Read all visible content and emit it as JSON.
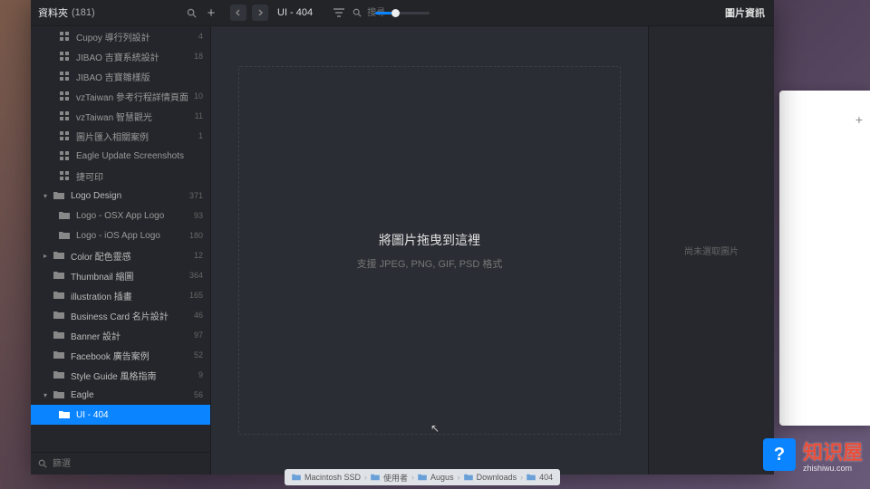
{
  "topbar": {
    "title_label": "資料夾",
    "title_count": "(181)",
    "breadcrumb": "UI - 404",
    "info_label": "圖片資訊",
    "search_placeholder": "搜尋",
    "slider_percent": 30
  },
  "sidebar": {
    "search_placeholder": "篩選",
    "items": [
      {
        "kind": "sub",
        "icon": "grid",
        "label": "Cupoy 導行列設計",
        "count": "4"
      },
      {
        "kind": "sub",
        "icon": "grid",
        "label": "JIBAO 吉寶系統設計",
        "count": "18"
      },
      {
        "kind": "sub",
        "icon": "grid",
        "label": "JIBAO 吉寶雛樣版",
        "count": ""
      },
      {
        "kind": "sub",
        "icon": "grid",
        "label": "vzTaiwan 參考行程詳情頁面",
        "count": "10"
      },
      {
        "kind": "sub",
        "icon": "grid",
        "label": "vzTaiwan 智慧觀光",
        "count": "11"
      },
      {
        "kind": "sub",
        "icon": "grid",
        "label": "圖片匯入相關案例",
        "count": "1"
      },
      {
        "kind": "sub",
        "icon": "grid",
        "label": "Eagle Update Screenshots",
        "count": ""
      },
      {
        "kind": "sub",
        "icon": "grid",
        "label": "捷可印",
        "count": ""
      },
      {
        "kind": "folder",
        "arrow": "▾",
        "label": "Logo Design",
        "count": "371"
      },
      {
        "kind": "sub",
        "icon": "folder",
        "label": "Logo - OSX App Logo",
        "count": "93"
      },
      {
        "kind": "sub",
        "icon": "folder",
        "label": "Logo - iOS App Logo",
        "count": "180"
      },
      {
        "kind": "folder",
        "arrow": "▸",
        "label": "Color 配色靈感",
        "count": "12"
      },
      {
        "kind": "folder",
        "arrow": "",
        "label": "Thumbnail 縮圖",
        "count": "364"
      },
      {
        "kind": "folder",
        "arrow": "",
        "label": "illustration 插畫",
        "count": "165"
      },
      {
        "kind": "folder",
        "arrow": "",
        "label": "Business Card 名片設計",
        "count": "46"
      },
      {
        "kind": "folder",
        "arrow": "",
        "label": "Banner 設計",
        "count": "97"
      },
      {
        "kind": "folder",
        "arrow": "",
        "label": "Facebook 廣告案例",
        "count": "52"
      },
      {
        "kind": "folder",
        "arrow": "",
        "label": "Style Guide 風格指南",
        "count": "9"
      },
      {
        "kind": "folder",
        "arrow": "▾",
        "label": "Eagle",
        "count": "56"
      },
      {
        "kind": "sub",
        "icon": "folder",
        "label": "UI - 404",
        "count": "",
        "selected": true
      }
    ]
  },
  "dropzone": {
    "title": "將圖片拖曳到這裡",
    "subtitle": "支援 JPEG, PNG, GIF, PSD 格式"
  },
  "info_panel": {
    "empty_text": "尚未選取圖片"
  },
  "pathbar": {
    "segments": [
      "Macintosh SSD",
      "使用者",
      "Augus",
      "Downloads",
      "404"
    ]
  },
  "watermark": {
    "text": "知识屋",
    "sub": "zhishiwu.com",
    "badge": "?"
  }
}
